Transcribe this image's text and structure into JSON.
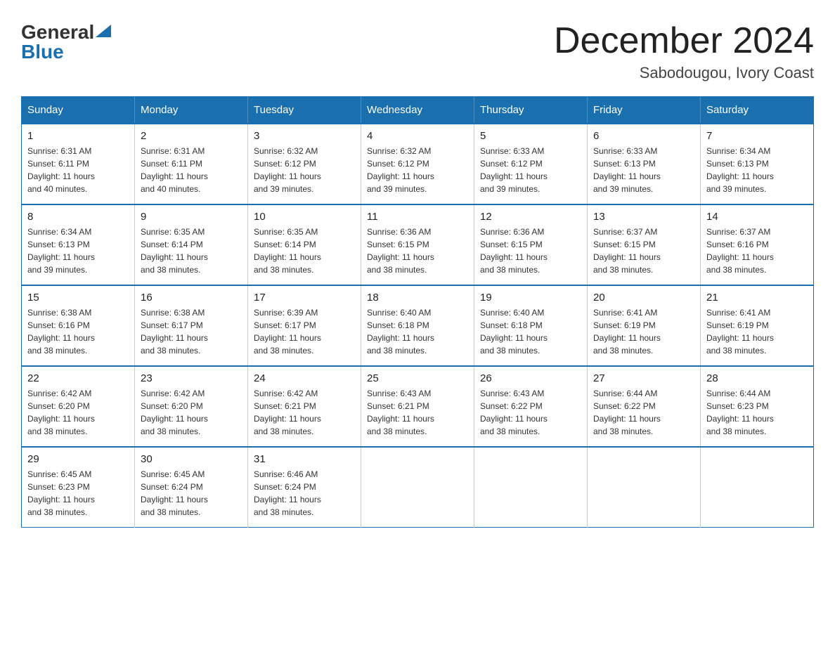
{
  "header": {
    "month_title": "December 2024",
    "location": "Sabodougou, Ivory Coast",
    "logo_general": "General",
    "logo_blue": "Blue"
  },
  "columns": [
    "Sunday",
    "Monday",
    "Tuesday",
    "Wednesday",
    "Thursday",
    "Friday",
    "Saturday"
  ],
  "weeks": [
    [
      {
        "day": "1",
        "sunrise": "6:31 AM",
        "sunset": "6:11 PM",
        "daylight": "11 hours and 40 minutes."
      },
      {
        "day": "2",
        "sunrise": "6:31 AM",
        "sunset": "6:11 PM",
        "daylight": "11 hours and 40 minutes."
      },
      {
        "day": "3",
        "sunrise": "6:32 AM",
        "sunset": "6:12 PM",
        "daylight": "11 hours and 39 minutes."
      },
      {
        "day": "4",
        "sunrise": "6:32 AM",
        "sunset": "6:12 PM",
        "daylight": "11 hours and 39 minutes."
      },
      {
        "day": "5",
        "sunrise": "6:33 AM",
        "sunset": "6:12 PM",
        "daylight": "11 hours and 39 minutes."
      },
      {
        "day": "6",
        "sunrise": "6:33 AM",
        "sunset": "6:13 PM",
        "daylight": "11 hours and 39 minutes."
      },
      {
        "day": "7",
        "sunrise": "6:34 AM",
        "sunset": "6:13 PM",
        "daylight": "11 hours and 39 minutes."
      }
    ],
    [
      {
        "day": "8",
        "sunrise": "6:34 AM",
        "sunset": "6:13 PM",
        "daylight": "11 hours and 39 minutes."
      },
      {
        "day": "9",
        "sunrise": "6:35 AM",
        "sunset": "6:14 PM",
        "daylight": "11 hours and 38 minutes."
      },
      {
        "day": "10",
        "sunrise": "6:35 AM",
        "sunset": "6:14 PM",
        "daylight": "11 hours and 38 minutes."
      },
      {
        "day": "11",
        "sunrise": "6:36 AM",
        "sunset": "6:15 PM",
        "daylight": "11 hours and 38 minutes."
      },
      {
        "day": "12",
        "sunrise": "6:36 AM",
        "sunset": "6:15 PM",
        "daylight": "11 hours and 38 minutes."
      },
      {
        "day": "13",
        "sunrise": "6:37 AM",
        "sunset": "6:15 PM",
        "daylight": "11 hours and 38 minutes."
      },
      {
        "day": "14",
        "sunrise": "6:37 AM",
        "sunset": "6:16 PM",
        "daylight": "11 hours and 38 minutes."
      }
    ],
    [
      {
        "day": "15",
        "sunrise": "6:38 AM",
        "sunset": "6:16 PM",
        "daylight": "11 hours and 38 minutes."
      },
      {
        "day": "16",
        "sunrise": "6:38 AM",
        "sunset": "6:17 PM",
        "daylight": "11 hours and 38 minutes."
      },
      {
        "day": "17",
        "sunrise": "6:39 AM",
        "sunset": "6:17 PM",
        "daylight": "11 hours and 38 minutes."
      },
      {
        "day": "18",
        "sunrise": "6:40 AM",
        "sunset": "6:18 PM",
        "daylight": "11 hours and 38 minutes."
      },
      {
        "day": "19",
        "sunrise": "6:40 AM",
        "sunset": "6:18 PM",
        "daylight": "11 hours and 38 minutes."
      },
      {
        "day": "20",
        "sunrise": "6:41 AM",
        "sunset": "6:19 PM",
        "daylight": "11 hours and 38 minutes."
      },
      {
        "day": "21",
        "sunrise": "6:41 AM",
        "sunset": "6:19 PM",
        "daylight": "11 hours and 38 minutes."
      }
    ],
    [
      {
        "day": "22",
        "sunrise": "6:42 AM",
        "sunset": "6:20 PM",
        "daylight": "11 hours and 38 minutes."
      },
      {
        "day": "23",
        "sunrise": "6:42 AM",
        "sunset": "6:20 PM",
        "daylight": "11 hours and 38 minutes."
      },
      {
        "day": "24",
        "sunrise": "6:42 AM",
        "sunset": "6:21 PM",
        "daylight": "11 hours and 38 minutes."
      },
      {
        "day": "25",
        "sunrise": "6:43 AM",
        "sunset": "6:21 PM",
        "daylight": "11 hours and 38 minutes."
      },
      {
        "day": "26",
        "sunrise": "6:43 AM",
        "sunset": "6:22 PM",
        "daylight": "11 hours and 38 minutes."
      },
      {
        "day": "27",
        "sunrise": "6:44 AM",
        "sunset": "6:22 PM",
        "daylight": "11 hours and 38 minutes."
      },
      {
        "day": "28",
        "sunrise": "6:44 AM",
        "sunset": "6:23 PM",
        "daylight": "11 hours and 38 minutes."
      }
    ],
    [
      {
        "day": "29",
        "sunrise": "6:45 AM",
        "sunset": "6:23 PM",
        "daylight": "11 hours and 38 minutes."
      },
      {
        "day": "30",
        "sunrise": "6:45 AM",
        "sunset": "6:24 PM",
        "daylight": "11 hours and 38 minutes."
      },
      {
        "day": "31",
        "sunrise": "6:46 AM",
        "sunset": "6:24 PM",
        "daylight": "11 hours and 38 minutes."
      },
      null,
      null,
      null,
      null
    ]
  ],
  "labels": {
    "sunrise": "Sunrise:",
    "sunset": "Sunset:",
    "daylight": "Daylight:"
  },
  "colors": {
    "header_bg": "#1a6faf",
    "header_text": "#ffffff",
    "border": "#1a6faf"
  }
}
